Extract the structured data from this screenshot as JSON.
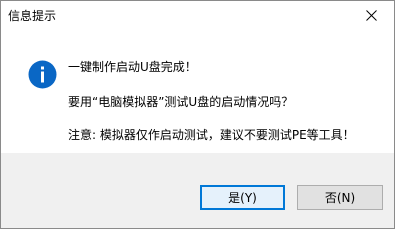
{
  "window": {
    "title": "信息提示"
  },
  "icons": {
    "close": "close-icon",
    "info": "info-icon"
  },
  "message": {
    "line1": "一键制作启动U盘完成！",
    "line2": "要用“电脑模拟器”测试U盘的启动情况吗？",
    "line3": "注意: 模拟器仅作启动测试，建议不要测试PE等工具！"
  },
  "buttons": {
    "yes": "是(Y)",
    "no": "否(N)"
  },
  "colors": {
    "info_icon": "#0a67c5",
    "focus_border": "#0078d7",
    "footer_bg": "#f0f0f0"
  }
}
